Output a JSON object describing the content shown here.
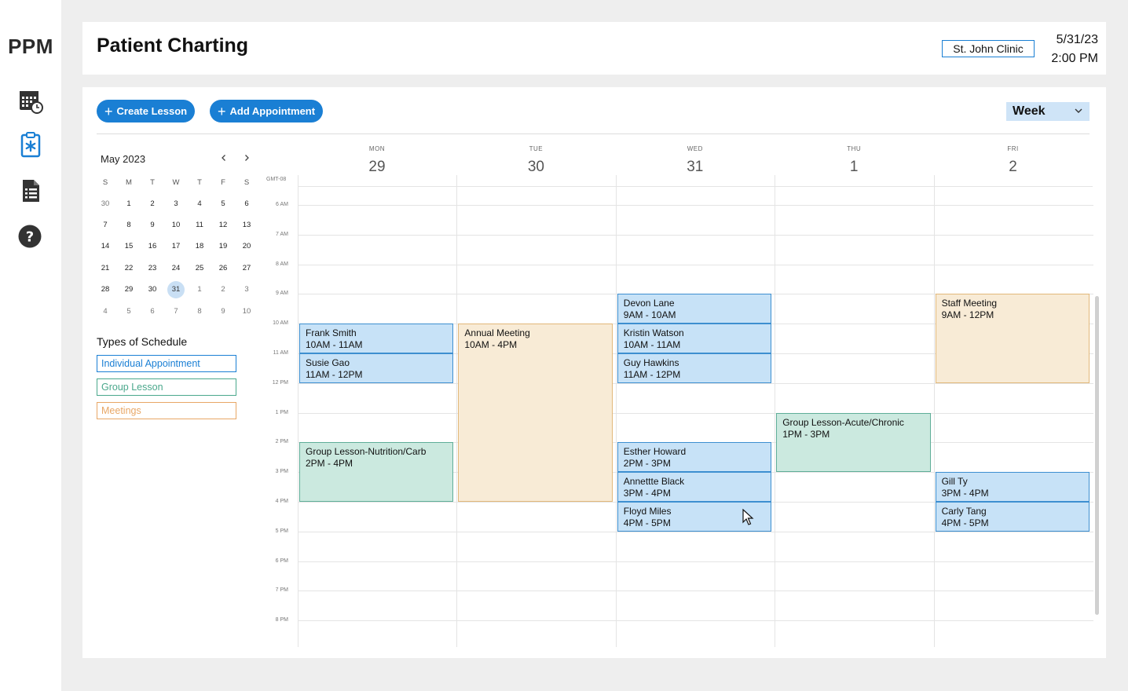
{
  "app": {
    "logo": "PPM"
  },
  "sidebar": {
    "items": [
      {
        "icon": "calendar-clock-icon",
        "label": "Schedule"
      },
      {
        "icon": "clipboard-medical-icon",
        "label": "Charting"
      },
      {
        "icon": "document-list-icon",
        "label": "Documents"
      },
      {
        "icon": "help-icon",
        "label": "Help"
      }
    ]
  },
  "header": {
    "title": "Patient Charting",
    "clinic": "St. John Clinic",
    "date": "5/31/23",
    "time": "2:00 PM"
  },
  "toolbar": {
    "create_lesson": "Create Lesson",
    "add_appointment": "Add Appointment",
    "view": "Week"
  },
  "mini_calendar": {
    "title": "May 2023",
    "weekdays": [
      "S",
      "M",
      "T",
      "W",
      "T",
      "F",
      "S"
    ],
    "weeks": [
      [
        "30",
        "1",
        "2",
        "3",
        "4",
        "5",
        "6"
      ],
      [
        "7",
        "8",
        "9",
        "10",
        "11",
        "12",
        "13"
      ],
      [
        "14",
        "15",
        "16",
        "17",
        "18",
        "19",
        "20"
      ],
      [
        "21",
        "22",
        "23",
        "24",
        "25",
        "26",
        "27"
      ],
      [
        "28",
        "29",
        "30",
        "31",
        "1",
        "2",
        "3"
      ],
      [
        "4",
        "5",
        "6",
        "7",
        "8",
        "9",
        "10"
      ]
    ],
    "selected": "31"
  },
  "types": {
    "title": "Types of Schedule",
    "items": [
      {
        "label": "Individual Appointment",
        "color": "#1a7fd4"
      },
      {
        "label": "Group Lesson",
        "color": "#4aa88c"
      },
      {
        "label": "Meetings",
        "color": "#e8a766"
      }
    ]
  },
  "calendar": {
    "timezone": "GMT-08",
    "days": [
      {
        "name": "MON",
        "num": "29"
      },
      {
        "name": "TUE",
        "num": "30"
      },
      {
        "name": "WED",
        "num": "31"
      },
      {
        "name": "THU",
        "num": "1"
      },
      {
        "name": "FRI",
        "num": "2"
      }
    ],
    "hours": [
      "6 AM",
      "7 AM",
      "8 AM",
      "9 AM",
      "10 AM",
      "11 AM",
      "12 PM",
      "1 PM",
      "2 PM",
      "3 PM",
      "4 PM",
      "5 PM",
      "6 PM",
      "7 PM",
      "8 PM"
    ],
    "events": [
      {
        "day": 0,
        "start": 10,
        "end": 11,
        "title": "Frank Smith",
        "time": "10AM - 11AM",
        "type": "appt"
      },
      {
        "day": 0,
        "start": 11,
        "end": 12,
        "title": "Susie Gao",
        "time": "11AM - 12PM",
        "type": "appt"
      },
      {
        "day": 0,
        "start": 14,
        "end": 16,
        "title": "Group Lesson-Nutrition/Carb",
        "time": "2PM - 4PM",
        "type": "group"
      },
      {
        "day": 1,
        "start": 10,
        "end": 16,
        "title": "Annual Meeting",
        "time": "10AM - 4PM",
        "type": "meet"
      },
      {
        "day": 2,
        "start": 9,
        "end": 10,
        "title": "Devon Lane",
        "time": "9AM - 10AM",
        "type": "appt"
      },
      {
        "day": 2,
        "start": 10,
        "end": 11,
        "title": "Kristin Watson",
        "time": "10AM - 11AM",
        "type": "appt"
      },
      {
        "day": 2,
        "start": 11,
        "end": 12,
        "title": "Guy Hawkins",
        "time": "11AM - 12PM",
        "type": "appt"
      },
      {
        "day": 2,
        "start": 14,
        "end": 15,
        "title": "Esther Howard",
        "time": "2PM - 3PM",
        "type": "appt"
      },
      {
        "day": 2,
        "start": 15,
        "end": 16,
        "title": "Annettte Black",
        "time": "3PM - 4PM",
        "type": "appt"
      },
      {
        "day": 2,
        "start": 16,
        "end": 17,
        "title": "Floyd Miles",
        "time": "4PM - 5PM",
        "type": "appt"
      },
      {
        "day": 3,
        "start": 13,
        "end": 15,
        "title": "Group Lesson-Acute/Chronic",
        "time": "1PM - 3PM",
        "type": "group"
      },
      {
        "day": 4,
        "start": 9,
        "end": 12,
        "title": "Staff Meeting",
        "time": "9AM - 12PM",
        "type": "meet"
      },
      {
        "day": 4,
        "start": 15,
        "end": 16,
        "title": "Gill Ty",
        "time": "3PM - 4PM",
        "type": "appt"
      },
      {
        "day": 4,
        "start": 16,
        "end": 17,
        "title": "Carly Tang",
        "time": "4PM - 5PM",
        "type": "appt"
      }
    ]
  }
}
